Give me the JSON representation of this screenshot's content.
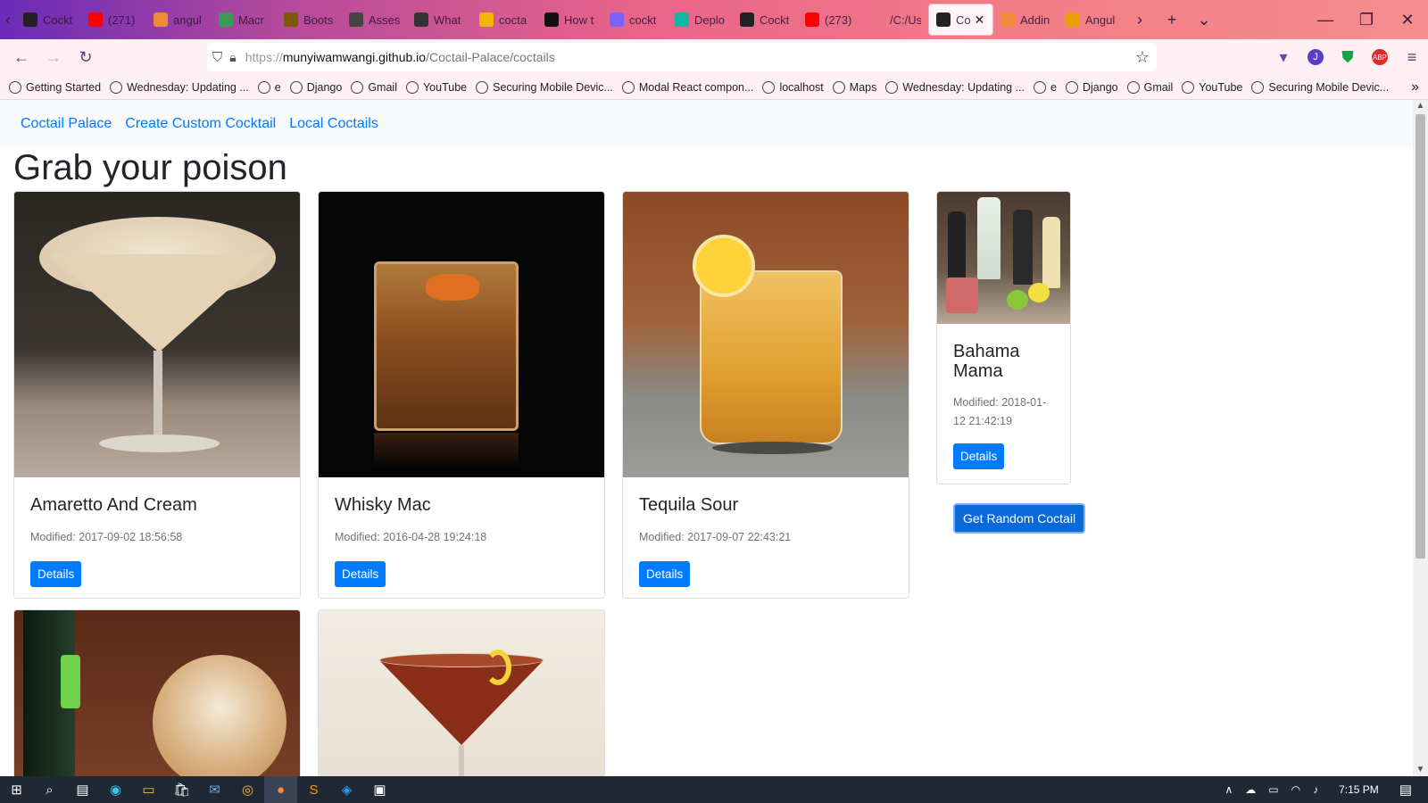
{
  "tabs": [
    {
      "label": "Cockt",
      "color": "#222"
    },
    {
      "label": "(271)",
      "color": "#ff0000"
    },
    {
      "label": "angul",
      "color": "#f08a3b"
    },
    {
      "label": "Macr",
      "color": "#3b9a5a"
    },
    {
      "label": "Boots",
      "color": "#7a5a00"
    },
    {
      "label": "Asses",
      "color": "#444"
    },
    {
      "label": "What",
      "color": "#333"
    },
    {
      "label": "cocta",
      "color": "#f5b400"
    },
    {
      "label": "How t",
      "color": "#111"
    },
    {
      "label": "cockt",
      "color": "#7b61ff"
    },
    {
      "label": "Deplo",
      "color": "#15b5a6"
    },
    {
      "label": "Cockt",
      "color": "#222"
    },
    {
      "label": "(273)",
      "color": "#ff0000"
    },
    {
      "label": "/C:/Users/",
      "color": "transparent"
    },
    {
      "label": "Co",
      "color": "#222",
      "active": true
    },
    {
      "label": "Addin",
      "color": "#f08a3b"
    },
    {
      "label": "Angul",
      "color": "#e8a000"
    }
  ],
  "url": {
    "scheme": "https://",
    "host": "munyiwamwangi.github.io",
    "path": "/Coctail-Palace/coctails"
  },
  "bookmarks": [
    "Getting Started",
    "Wednesday: Updating ...",
    "e",
    "Django",
    "Gmail",
    "YouTube",
    "Securing Mobile Devic...",
    "Modal React compon...",
    "localhost",
    "Maps",
    "Wednesday: Updating ...",
    "e",
    "Django",
    "Gmail",
    "YouTube",
    "Securing Mobile Devic..."
  ],
  "nav": {
    "brand": "Coctail Palace",
    "create": "Create Custom Cocktail",
    "local": "Local Coctails"
  },
  "heading": "Grab your poison",
  "cards": [
    {
      "name": "Amaretto And Cream",
      "modified": "Modified: 2017-09-02 18:56:58",
      "button": "Details"
    },
    {
      "name": "Whisky Mac",
      "modified": "Modified: 2016-04-28 19:24:18",
      "button": "Details"
    },
    {
      "name": "Tequila Sour",
      "modified": "Modified: 2017-09-07 22:43:21",
      "button": "Details"
    },
    {
      "name": "Bahama Mama",
      "modified": "Modified: 2018-01-12 21:42:19",
      "button": "Details"
    }
  ],
  "random_button": "Get Random Coctail",
  "clock": "7:15 PM"
}
